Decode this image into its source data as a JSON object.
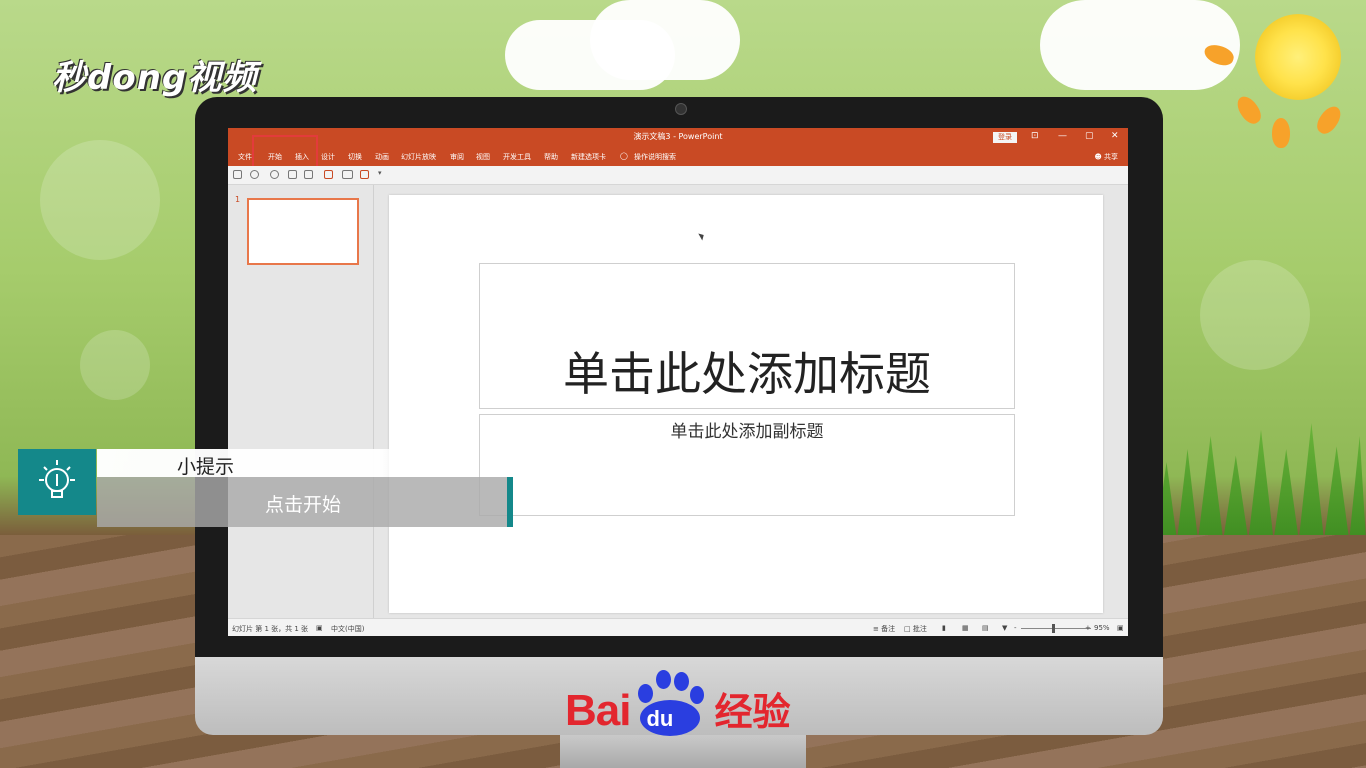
{
  "brand_logo": "秒dong视频",
  "powerpoint": {
    "window_title": "演示文稿3 - PowerPoint",
    "login_label": "登录",
    "window_controls": [
      "⊡",
      "—",
      "▢",
      "✕"
    ],
    "ribbon_tabs": [
      "文件",
      "开始",
      "插入",
      "设计",
      "切换",
      "动画",
      "幻灯片放映",
      "审阅",
      "视图",
      "开发工具",
      "帮助",
      "新建选项卡"
    ],
    "tell_me": "操作说明搜索",
    "share_label": "共享",
    "slide_number": "1",
    "title_placeholder": "单击此处添加标题",
    "subtitle_placeholder": "单击此处添加副标题",
    "status": {
      "slide_info": "幻灯片 第 1 张，共 1 张",
      "language": "中文(中国)",
      "notes": "备注",
      "comments": "批注",
      "zoom": "95%"
    }
  },
  "tip": {
    "heading": "小提示",
    "text": "点击开始"
  },
  "footer_brand": {
    "bai": "Bai",
    "du": "du",
    "jingyan": "经验"
  },
  "colors": {
    "ppt_accent": "#c94a24",
    "tip_teal": "#14888a",
    "baidu_red": "#e3262e",
    "baidu_blue": "#2a3ee0"
  }
}
